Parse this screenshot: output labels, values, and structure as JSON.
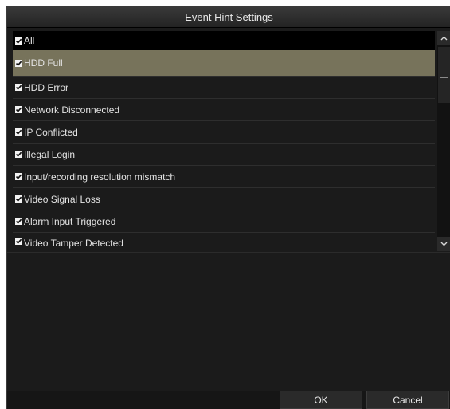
{
  "dialog": {
    "title": "Event Hint Settings"
  },
  "list": {
    "header_label": "All",
    "header_checked": true,
    "items": [
      {
        "label": "HDD Full",
        "checked": true,
        "selected": true
      },
      {
        "label": "HDD Error",
        "checked": true
      },
      {
        "label": "Network Disconnected",
        "checked": true
      },
      {
        "label": "IP Conflicted",
        "checked": true
      },
      {
        "label": "Illegal Login",
        "checked": true
      },
      {
        "label": "Input/recording resolution mismatch",
        "checked": true
      },
      {
        "label": "Video Signal Loss",
        "checked": true
      },
      {
        "label": "Alarm Input Triggered",
        "checked": true
      },
      {
        "label": "Video Tamper Detected",
        "checked": true
      }
    ]
  },
  "buttons": {
    "ok": "OK",
    "cancel": "Cancel"
  },
  "colors": {
    "background": "#1b1b1b",
    "selected_row": "#77735b",
    "text": "#e4e4e4"
  },
  "icons": {
    "checkbox": "checkbox-checked-icon",
    "scroll_up": "chevron-up-icon",
    "scroll_down": "chevron-down-icon",
    "grip": "scroll-grip-icon"
  }
}
